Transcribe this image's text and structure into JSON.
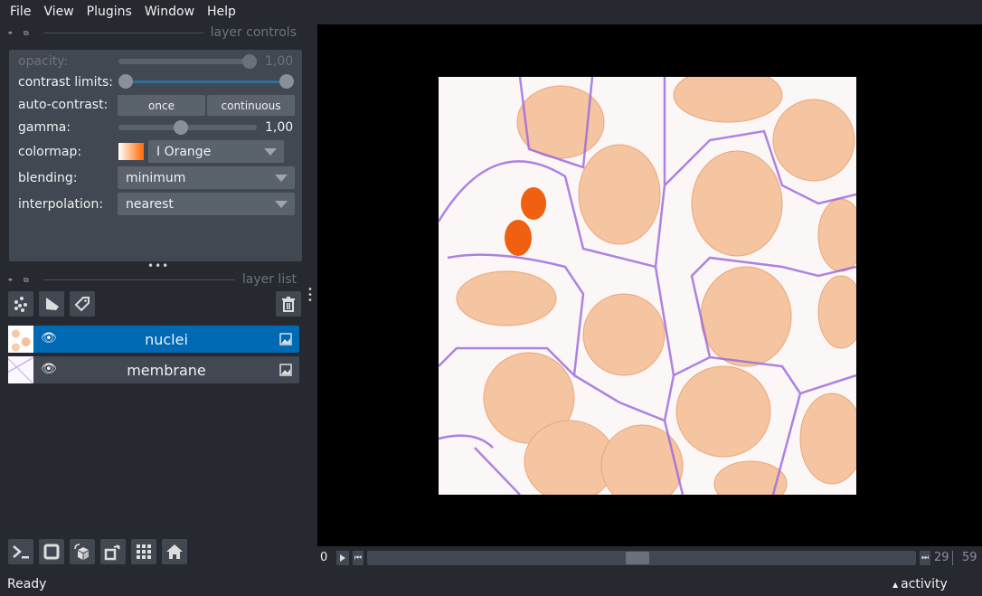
{
  "menu": [
    "File",
    "View",
    "Plugins",
    "Window",
    "Help"
  ],
  "layer_controls": {
    "title": "layer controls",
    "opacity": {
      "label": "opacity:",
      "value": "1,00",
      "fraction": 1.0
    },
    "contrast_limits": {
      "label": "contrast limits:",
      "low": 0.0,
      "high": 1.0
    },
    "auto_contrast": {
      "label": "auto-contrast:",
      "once": "once",
      "continuous": "continuous"
    },
    "gamma": {
      "label": "gamma:",
      "value": "1,00",
      "fraction": 0.5
    },
    "colormap": {
      "label": "colormap:",
      "value": "I Orange",
      "swatch_from": "#ffffff",
      "swatch_to": "#ff6a00"
    },
    "blending": {
      "label": "blending:",
      "value": "minimum"
    },
    "interpolation": {
      "label": "interpolation:",
      "value": "nearest"
    }
  },
  "layer_list": {
    "title": "layer list",
    "layers": [
      {
        "name": "nuclei",
        "selected": true,
        "visible": true,
        "type": "image"
      },
      {
        "name": "membrane",
        "selected": false,
        "visible": true,
        "type": "image"
      }
    ]
  },
  "dims": {
    "start": "0",
    "current": "29",
    "max": "59",
    "fraction": 0.49
  },
  "status": {
    "text": "Ready",
    "activity": "activity"
  },
  "colors": {
    "accent": "#0069b4",
    "background": "#262930",
    "panel": "#414851",
    "nuclei": "#f0a070",
    "membrane": "#8a4fd8"
  }
}
